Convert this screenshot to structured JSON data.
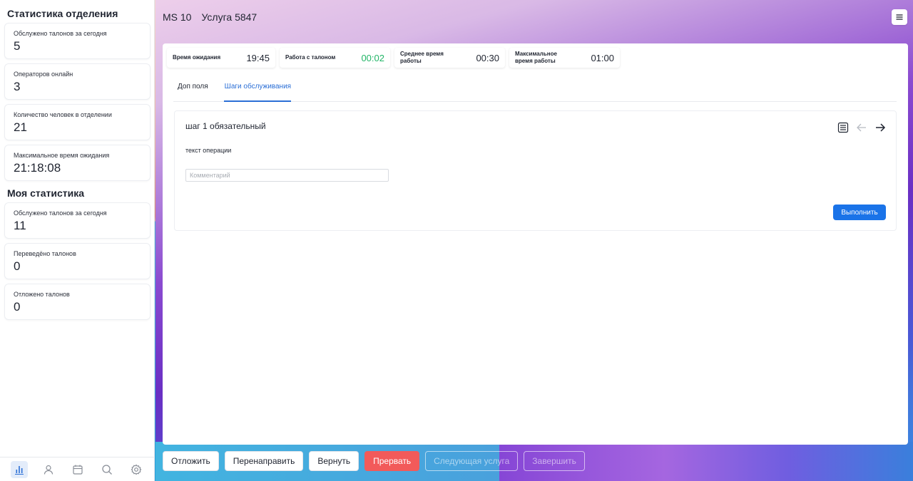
{
  "header": {
    "code": "MS 10",
    "service": "Услуга 5847"
  },
  "sidebar": {
    "dept_title": "Статистика отделения",
    "dept_stats": [
      {
        "label": "Обслужено талонов за сегодня",
        "value": "5"
      },
      {
        "label": "Операторов онлайн",
        "value": "3"
      },
      {
        "label": "Количество человек в отделении",
        "value": "21"
      },
      {
        "label": "Максимальное время ожидания",
        "value": "21:18:08"
      }
    ],
    "my_title": "Моя статистика",
    "my_stats": [
      {
        "label": "Обслужено талонов за сегодня",
        "value": "11"
      },
      {
        "label": "Переведёно талонов",
        "value": "0"
      },
      {
        "label": "Отложено талонов",
        "value": "0"
      }
    ],
    "nav_icons": [
      "chart-icon",
      "user-icon",
      "calendar-icon",
      "search-icon",
      "gear-icon"
    ]
  },
  "timers": [
    {
      "label": "Время ожидания",
      "value": "19:45"
    },
    {
      "label": "Работа с талоном",
      "value": "00:02",
      "color": "#22b567"
    },
    {
      "label": "Среднее время работы",
      "value": "00:30"
    },
    {
      "label": "Максимальное время работы",
      "value": "01:00"
    }
  ],
  "tabs": [
    {
      "label": "Доп поля"
    },
    {
      "label": "Шаги обслуживания",
      "active": true
    }
  ],
  "step": {
    "title": "шаг 1 обязательный",
    "text": "текст операции",
    "comment_placeholder": "Комментарий",
    "execute_label": "Выполнить"
  },
  "actions": {
    "postpone": "Отложить",
    "redirect": "Перенаправить",
    "return": "Вернуть",
    "abort": "Прервать",
    "next_service": "Следующая услуга",
    "finish": "Завершить"
  },
  "colors": {
    "accent": "#1a73e8",
    "danger": "#f25a5a",
    "success": "#22b567"
  }
}
